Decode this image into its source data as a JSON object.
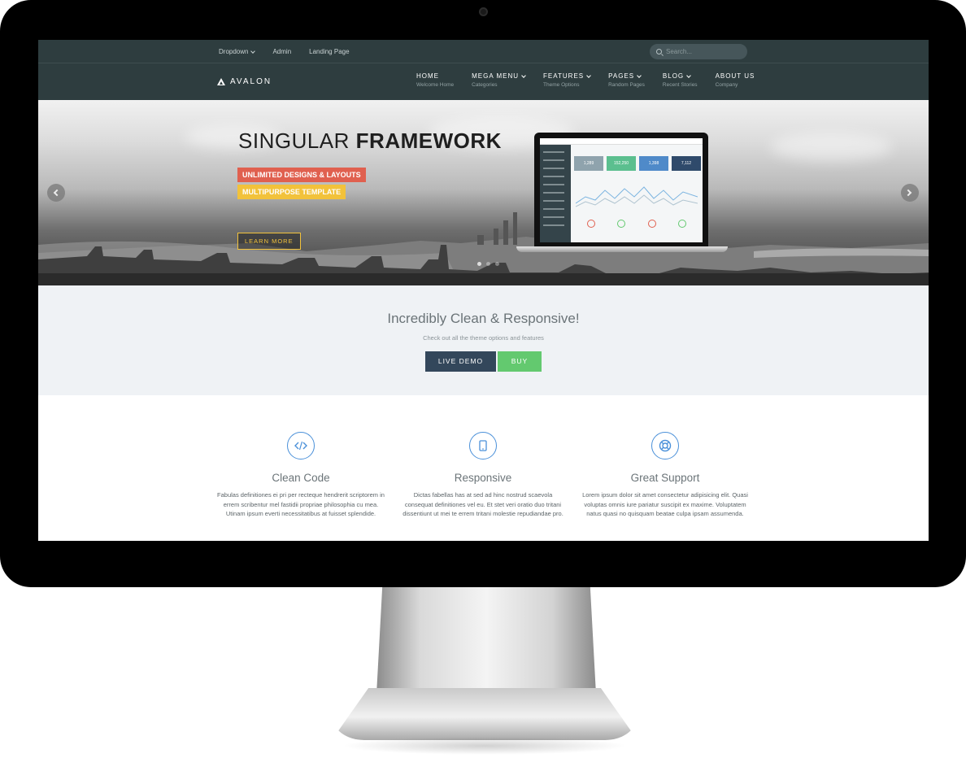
{
  "topbar": {
    "links": [
      {
        "label": "Dropdown",
        "has_caret": true
      },
      {
        "label": "Admin",
        "has_caret": false
      },
      {
        "label": "Landing Page",
        "has_caret": false
      }
    ],
    "search": {
      "placeholder": "Search..."
    }
  },
  "navbar": {
    "brand": "AVALON",
    "brand_icon": "triangle-logo-icon",
    "items": [
      {
        "title": "HOME",
        "subtitle": "Welcome Home",
        "has_caret": false
      },
      {
        "title": "MEGA MENU",
        "subtitle": "Categories",
        "has_caret": true
      },
      {
        "title": "FEATURES",
        "subtitle": "Theme Options",
        "has_caret": true
      },
      {
        "title": "PAGES",
        "subtitle": "Random Pages",
        "has_caret": true
      },
      {
        "title": "BLOG",
        "subtitle": "Recent Stories",
        "has_caret": true
      },
      {
        "title": "ABOUT US",
        "subtitle": "Company",
        "has_caret": false
      }
    ]
  },
  "hero": {
    "title_light": "SINGULAR ",
    "title_bold": "FRAMEWORK",
    "tag_primary": "UNLIMITED DESIGNS & LAYOUTS",
    "tag_secondary": "MULTIPURPOSE TEMPLATE",
    "cta_label": "LEARN MORE",
    "slides_total": 3,
    "active_slide": 1,
    "laptop_cards": [
      {
        "value": "1,289",
        "color": "#8fa3ad"
      },
      {
        "value": "152,250",
        "color": "#5bbf8f"
      },
      {
        "value": "1,398",
        "color": "#4f8ac9"
      },
      {
        "value": "7,112",
        "color": "#2f4a6b"
      }
    ]
  },
  "cta": {
    "title": "Incredibly Clean & Responsive!",
    "subtitle": "Check out all the theme options and features",
    "demo_label": "LIVE DEMO",
    "buy_label": "BUY"
  },
  "features": [
    {
      "icon": "code-icon",
      "title": "Clean Code",
      "text": "Fabulas definitiones ei pri per recteque hendrerit scriptorem in errem scribentur mel fastidii propriae philosophia cu mea. Utinam ipsum everti necessitatibus at fuisset splendide."
    },
    {
      "icon": "tablet-icon",
      "title": "Responsive",
      "text": "Dictas fabellas has at sed ad hinc nostrud scaevola consequat definitiones vel eu. Et stet veri oratio duo tritani dissentiunt ut mei te errem tritani molestie repudiandae pro."
    },
    {
      "icon": "life-ring-icon",
      "title": "Great Support",
      "text": "Lorem ipsum dolor sit amet consectetur adipisicing elit. Quasi voluptas omnis iure pariatur suscipit ex maxime. Voluptatem natus quasi no quisquam beatae culpa ipsam assumenda."
    }
  ],
  "colors": {
    "nav_bg": "#2e3d3f",
    "accent_red": "#e0604f",
    "accent_yellow": "#f2c23b",
    "demo_btn": "#33475b",
    "buy_btn": "#63c96f",
    "icon_blue": "#4a90d9"
  }
}
